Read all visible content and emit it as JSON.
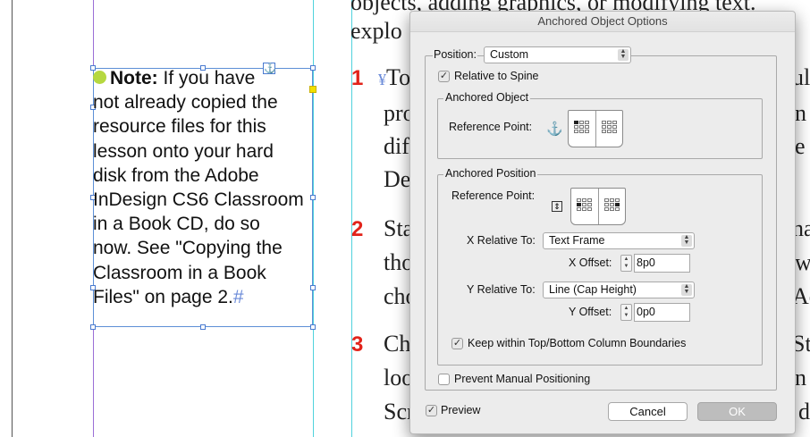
{
  "document": {
    "note_label": "Note:",
    "note_lines": [
      "If you have",
      "not already copied the",
      "resource files for this",
      "lesson onto your hard",
      "disk from the Adobe",
      "InDesign CS6 Classroom",
      "in a Book CD, do so",
      "now. See \"Copying the",
      "Classroom in a Book",
      "Files\" on page 2."
    ],
    "note_end_mark": "#",
    "anchor_marker": "⚓",
    "body_lines": [
      {
        "text": "objects, adding graphics, or modifying text."
      },
      {
        "text": "explo"
      }
    ],
    "steps": [
      {
        "number": "1",
        "marker": "¥",
        "lines": [
          "To",
          "pro",
          "dif",
          "De"
        ]
      },
      {
        "number": "2",
        "lines": [
          "Sta",
          "tho",
          "cho"
        ]
      },
      {
        "number": "3",
        "lines": [
          "Ch",
          "loo",
          "Scr"
        ]
      }
    ],
    "right_fragments": [
      "ul",
      "n",
      "e",
      "na",
      "w",
      "Ac",
      "Sta",
      "n",
      "d"
    ]
  },
  "dialog": {
    "title": "Anchored Object Options",
    "position_label": "Position:",
    "position_value": "Custom",
    "relative_to_spine_label": "Relative to Spine",
    "relative_to_spine_checked": true,
    "anchored_object": {
      "group_label": "Anchored Object",
      "reference_point_label": "Reference Point:"
    },
    "anchored_position": {
      "group_label": "Anchored Position",
      "reference_point_label": "Reference Point:",
      "x_relative_label": "X Relative To:",
      "x_relative_value": "Text Frame",
      "x_offset_label": "X Offset:",
      "x_offset_value": "8p0",
      "y_relative_label": "Y Relative To:",
      "y_relative_value": "Line (Cap Height)",
      "y_offset_label": "Y Offset:",
      "y_offset_value": "0p0",
      "keep_within_label": "Keep within Top/Bottom Column Boundaries",
      "keep_within_checked": true
    },
    "prevent_manual_label": "Prevent Manual Positioning",
    "prevent_manual_checked": false,
    "preview_label": "Preview",
    "preview_checked": true,
    "cancel_label": "Cancel",
    "ok_label": "OK"
  },
  "colors": {
    "step_number": "#e2231a",
    "bullet": "#b6d840",
    "frame_border": "#5d8fd6",
    "guide_cyan": "#4fd2dc",
    "guide_purple": "#9b6fd6"
  }
}
